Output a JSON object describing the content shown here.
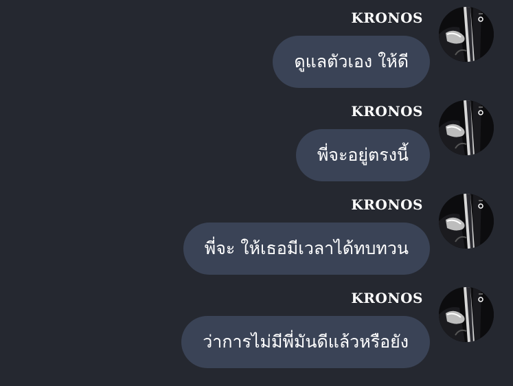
{
  "messages": [
    {
      "sender": "KRONOS",
      "text": "ดูแลตัวเอง ให้ดี",
      "avatar_icon": "profile-photo-suit"
    },
    {
      "sender": "KRONOS",
      "text": "พี่จะอยู่ตรงนี้",
      "avatar_icon": "profile-photo-suit"
    },
    {
      "sender": "KRONOS",
      "text": "พี่จะ ให้เธอมีเวลาได้ทบทวน",
      "avatar_icon": "profile-photo-suit"
    },
    {
      "sender": "KRONOS",
      "text": "ว่าการไม่มีพี่มันดีแล้วหรือยัง",
      "avatar_icon": "profile-photo-suit"
    }
  ],
  "colors": {
    "background": "#252830",
    "bubble": "#3a4356",
    "text": "#ffffff"
  }
}
